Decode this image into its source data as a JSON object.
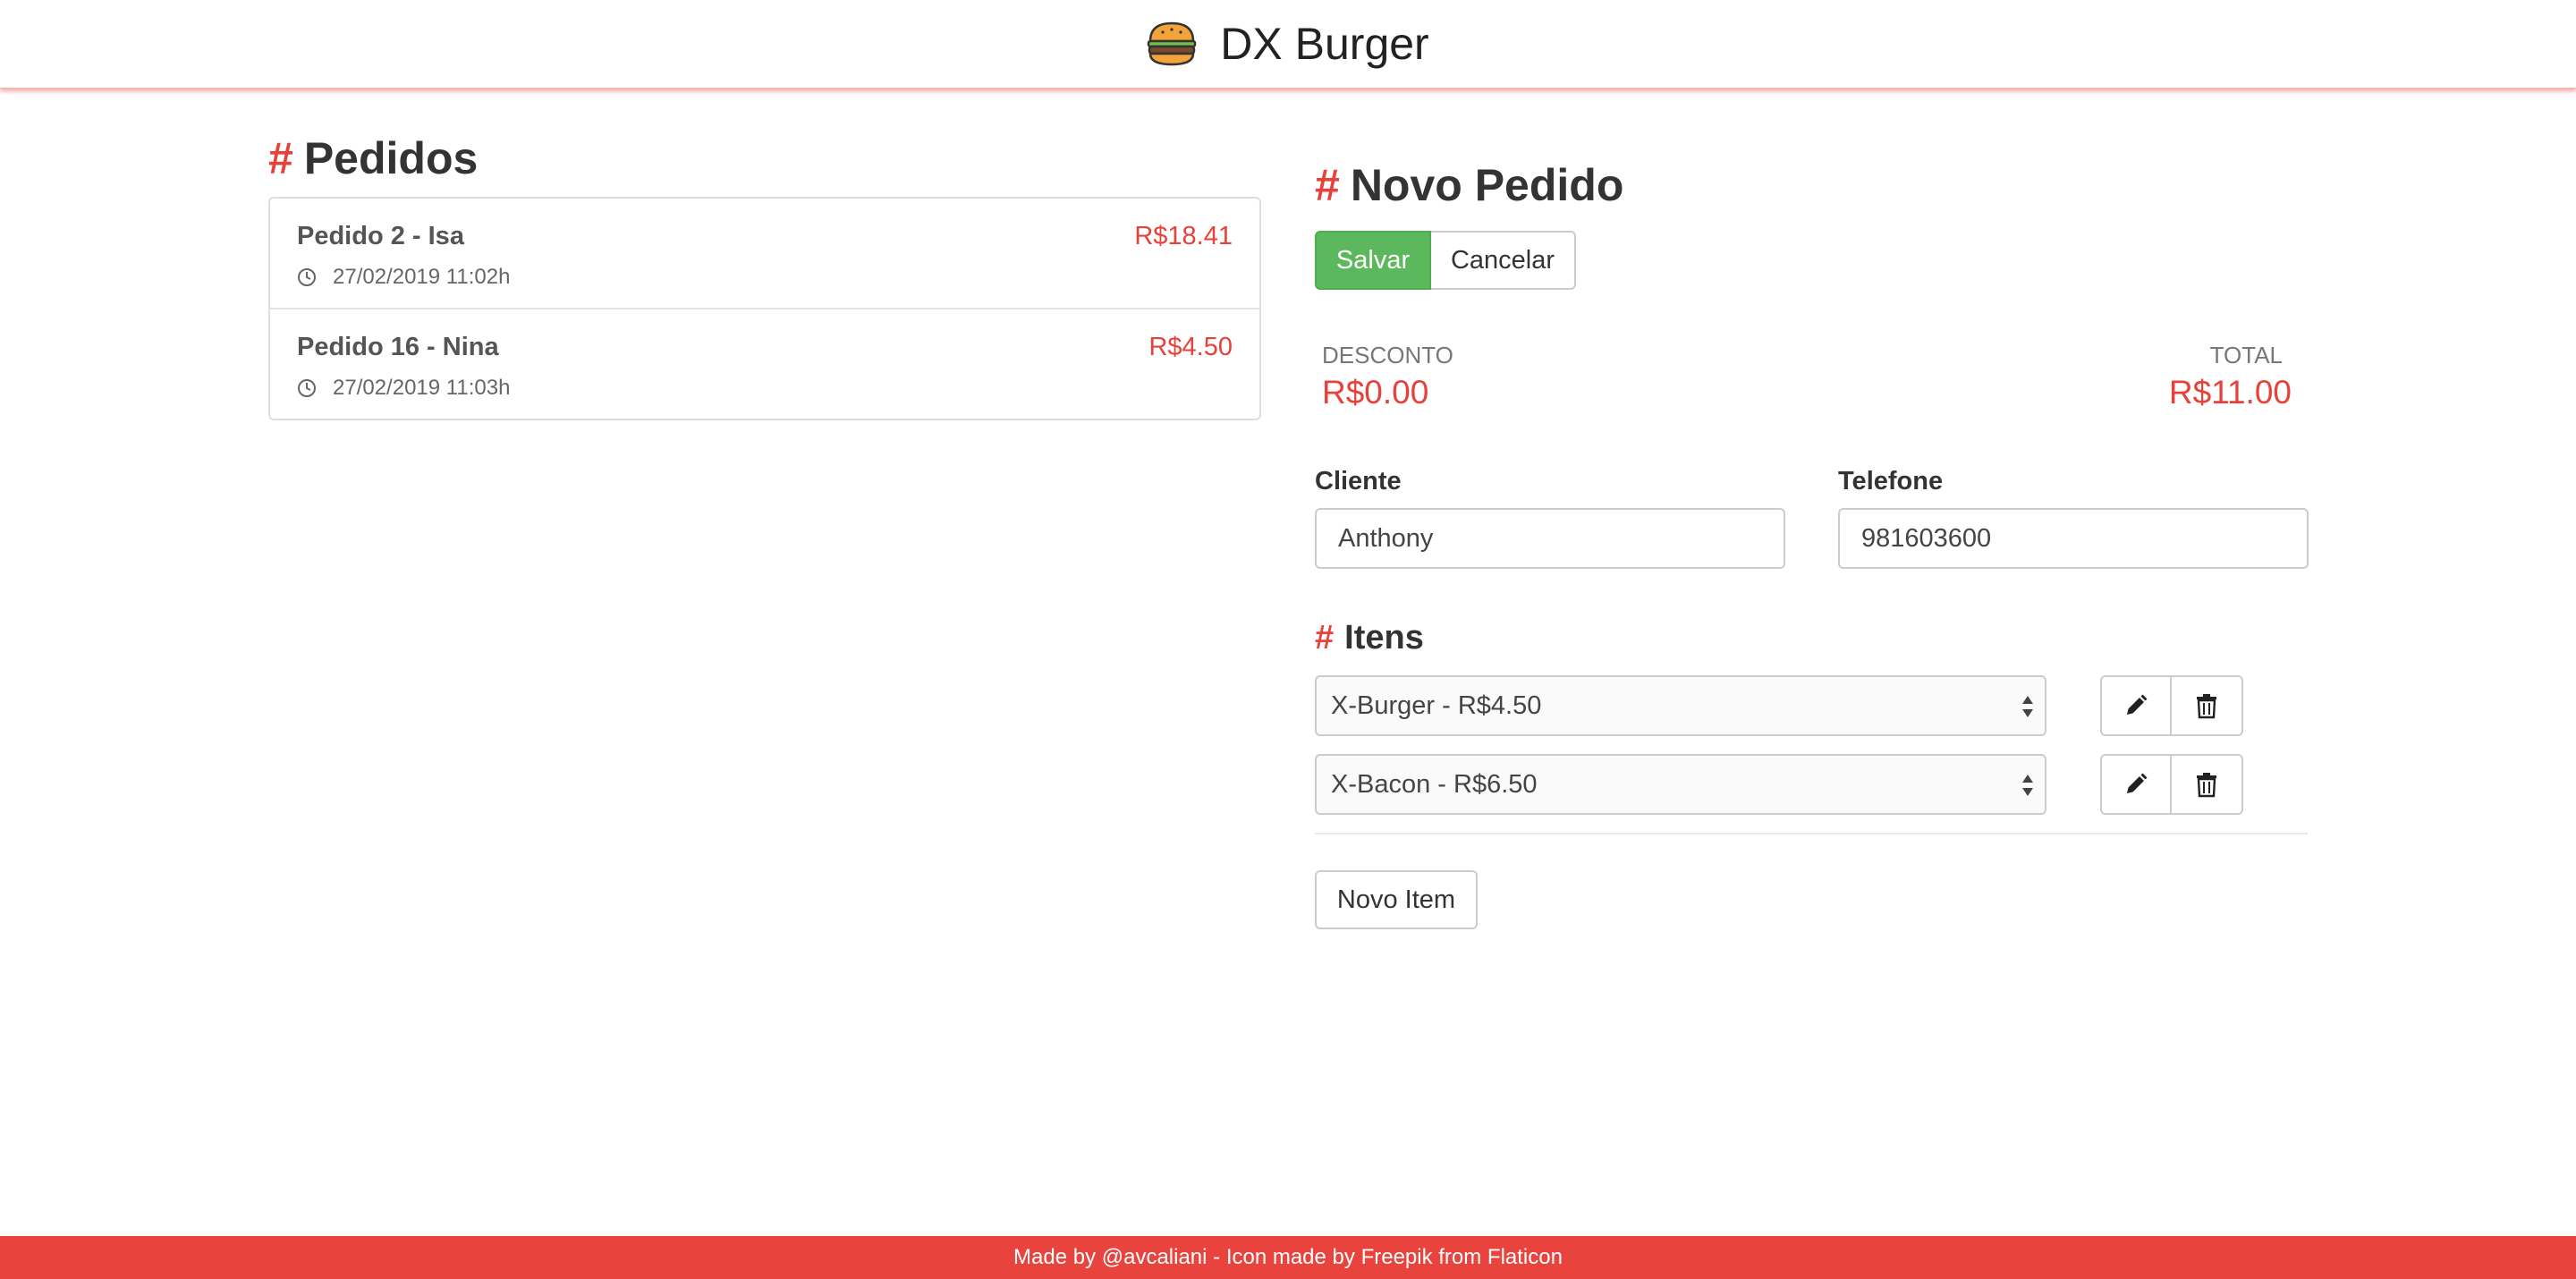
{
  "header": {
    "brand": "DX Burger",
    "logo_icon": "burger-icon"
  },
  "orders": {
    "title_hash": "#",
    "title": "Pedidos",
    "items": [
      {
        "name": "Pedido 2 - Isa",
        "price": "R$18.41",
        "time": "27/02/2019 11:02h"
      },
      {
        "name": "Pedido 16 - Nina",
        "price": "R$4.50",
        "time": "27/02/2019 11:03h"
      }
    ]
  },
  "new_order": {
    "title_hash": "#",
    "title": "Novo Pedido",
    "save_label": "Salvar",
    "cancel_label": "Cancelar",
    "discount_label": "DESCONTO",
    "discount_value": "R$0.00",
    "total_label": "TOTAL",
    "total_value": "R$11.00",
    "client_label": "Cliente",
    "client_value": "Anthony",
    "phone_label": "Telefone",
    "phone_value": "981603600",
    "items_title_hash": "#",
    "items_title": "Itens",
    "items": [
      {
        "selected": "X-Burger - R$4.50"
      },
      {
        "selected": "X-Bacon - R$6.50"
      }
    ],
    "new_item_label": "Novo Item"
  },
  "footer": {
    "text": "Made by @avcaliani - Icon made by Freepik from Flaticon"
  },
  "colors": {
    "accent": "#e8413a",
    "success": "#5cb85c",
    "footer_bg": "#e8443d"
  }
}
